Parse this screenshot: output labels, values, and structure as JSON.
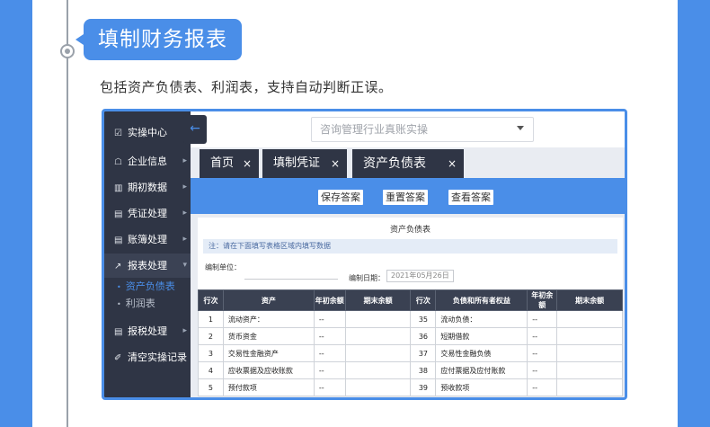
{
  "header": {
    "title": "填制财务报表",
    "description": "包括资产负债表、利润表，支持自动判断正误。"
  },
  "sidebar": {
    "items": [
      {
        "label": "实操中心",
        "icon": "☑"
      },
      {
        "label": "企业信息",
        "icon": "☖"
      },
      {
        "label": "期初数据",
        "icon": "▥"
      },
      {
        "label": "凭证处理",
        "icon": "▤"
      },
      {
        "label": "账簿处理",
        "icon": "▤"
      },
      {
        "label": "报表处理",
        "icon": "↗"
      },
      {
        "label": "报税处理",
        "icon": "▤"
      },
      {
        "label": "清空实操记录",
        "icon": "✐"
      }
    ],
    "subitems": [
      "资产负债表",
      "利润表"
    ]
  },
  "topbar": {
    "back_icon": "←",
    "select_placeholder": "咨询管理行业真账实操"
  },
  "tabs": [
    {
      "label": "首页",
      "close": "×"
    },
    {
      "label": "填制凭证",
      "close": "×"
    },
    {
      "label": "资产负债表",
      "close": "×"
    }
  ],
  "toolbar": {
    "save": "保存答案",
    "reset": "重置答案",
    "view": "查看答案"
  },
  "sheet": {
    "title": "资产负债表",
    "notice": "注：请在下面填写表格区域内填写数据",
    "unit_label": "编制单位：",
    "date_label": "编制日期：",
    "date_value": "2021年05月26日",
    "columns": [
      "行次",
      "资产",
      "年初余额",
      "期末余额",
      "行次",
      "负债和所有者权益",
      "年初余额",
      "期末余额"
    ],
    "rows": [
      [
        "1",
        "流动资产：",
        "--",
        "",
        "35",
        "流动负债：",
        "--",
        ""
      ],
      [
        "2",
        "货币资金",
        "--",
        "",
        "36",
        "短期借款",
        "--",
        ""
      ],
      [
        "3",
        "交易性金融资产",
        "--",
        "",
        "37",
        "交易性金融负债",
        "--",
        ""
      ],
      [
        "4",
        "应收票据及应收账款",
        "--",
        "",
        "38",
        "应付票据及应付账款",
        "--",
        ""
      ],
      [
        "5",
        "预付款项",
        "--",
        "",
        "39",
        "预收款项",
        "--",
        ""
      ]
    ]
  },
  "colors": {
    "accent": "#4a8ee8",
    "sidebar_bg": "#2f3545"
  }
}
